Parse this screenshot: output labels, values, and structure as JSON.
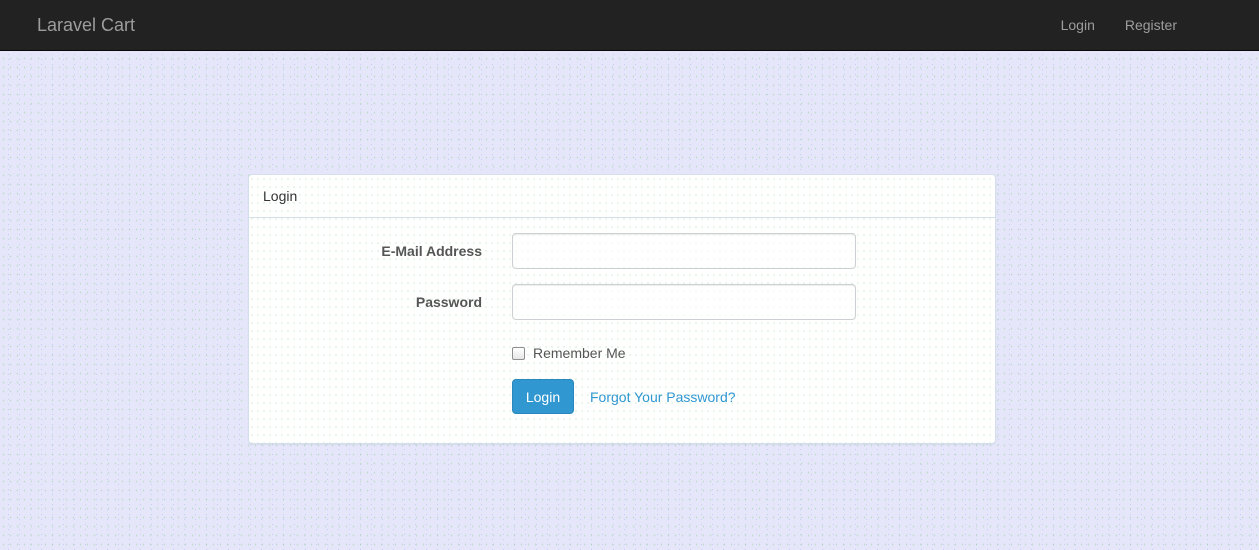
{
  "navbar": {
    "brand": "Laravel Cart",
    "links": [
      {
        "label": "Login"
      },
      {
        "label": "Register"
      }
    ]
  },
  "login_panel": {
    "heading": "Login",
    "email": {
      "label": "E-Mail Address",
      "value": ""
    },
    "password": {
      "label": "Password",
      "value": ""
    },
    "remember": {
      "label": "Remember Me",
      "checked": false
    },
    "submit_label": "Login",
    "forgot_label": "Forgot Your Password?"
  },
  "colors": {
    "navbar_bg": "#222222",
    "page_bg": "#e6e6fa",
    "primary": "#3097d1"
  }
}
